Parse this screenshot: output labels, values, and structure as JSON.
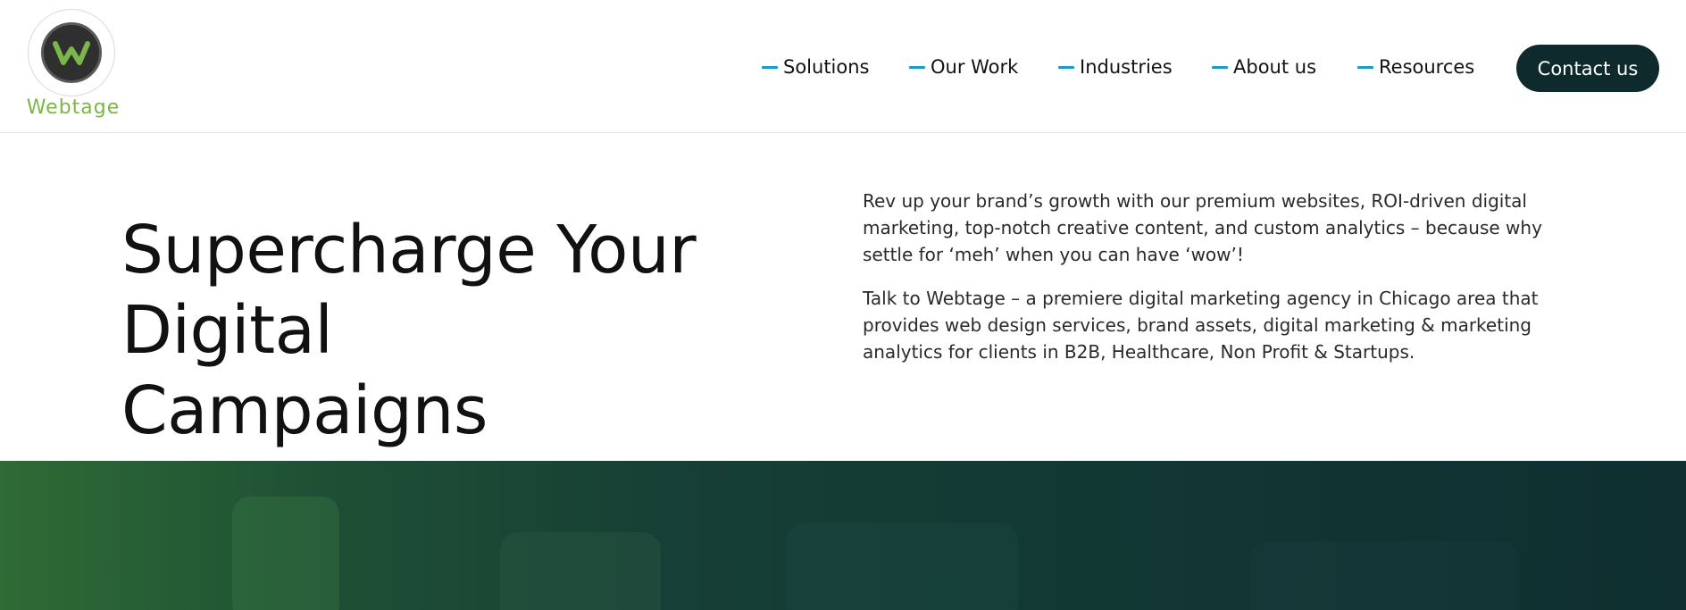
{
  "brand": {
    "name": "Webtage",
    "logo_letter": "W",
    "colors": {
      "green": "#7ab648",
      "dark": "#0e2a2c",
      "accent": "#1a9bc7"
    }
  },
  "nav": {
    "items": [
      {
        "label": "Solutions"
      },
      {
        "label": "Our Work"
      },
      {
        "label": "Industries"
      },
      {
        "label": "About us"
      },
      {
        "label": "Resources"
      }
    ],
    "contact_label": "Contact us"
  },
  "hero": {
    "title_line1": "Supercharge Your",
    "title_line2": "Digital Campaigns",
    "paragraph1": "Rev up your brand’s growth with our premium websites, ROI-driven digital marketing, top-notch creative content, and custom analytics – because why settle for ‘meh’ when you can have ‘wow’!",
    "paragraph2": "Talk to Webtage – a premiere digital marketing agency in Chicago area that provides web design services, brand assets, digital marketing & marketing analytics for clients in B2B, Healthcare, Non Profit & Startups."
  }
}
